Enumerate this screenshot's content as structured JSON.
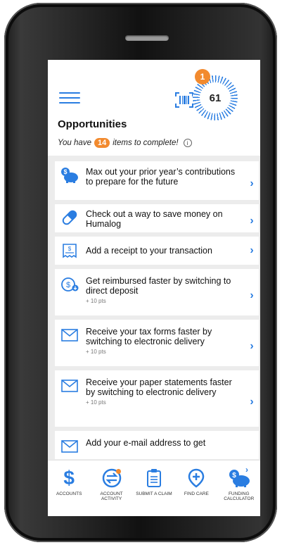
{
  "header": {
    "notification_count": "1",
    "score": "61",
    "title": "Opportunities",
    "subtitle_prefix": "You have",
    "items_count": "14",
    "subtitle_suffix": "items to complete!",
    "info_glyph": "i"
  },
  "opportunities": [
    {
      "icon": "piggy-bank-icon",
      "text": "Max out your prior year’s contributions to prepare for the future",
      "points": ""
    },
    {
      "icon": "pill-icon",
      "text": "Check out a way to save money on Humalog",
      "points": ""
    },
    {
      "icon": "receipt-icon",
      "text": "Add a receipt to your transaction",
      "points": ""
    },
    {
      "icon": "direct-deposit-icon",
      "text": "Get reimbursed faster by switching to direct deposit",
      "points": "+ 10 pts"
    },
    {
      "icon": "envelope-icon",
      "text": "Receive your tax forms faster by switching to electronic delivery",
      "points": "+ 10 pts"
    },
    {
      "icon": "envelope-icon",
      "text": "Receive your paper statements faster by switching to electronic delivery",
      "points": "+ 10 pts"
    },
    {
      "icon": "envelope-icon",
      "text": "Add your e-mail address to get",
      "points": ""
    }
  ],
  "chevron": "›",
  "tabs": [
    {
      "icon": "dollar-icon",
      "label": "ACCOUNTS",
      "glyph": "$"
    },
    {
      "icon": "account-activity-icon",
      "label": "ACCOUNT ACTIVITY"
    },
    {
      "icon": "clipboard-icon",
      "label": "SUBMIT A CLAIM"
    },
    {
      "icon": "location-pin-icon",
      "label": "FIND CARE"
    },
    {
      "icon": "piggy-bank-icon",
      "label": "FUNDING CALCULATOR"
    }
  ],
  "colors": {
    "accent": "#2a7de1",
    "badge": "#f28a2e"
  }
}
